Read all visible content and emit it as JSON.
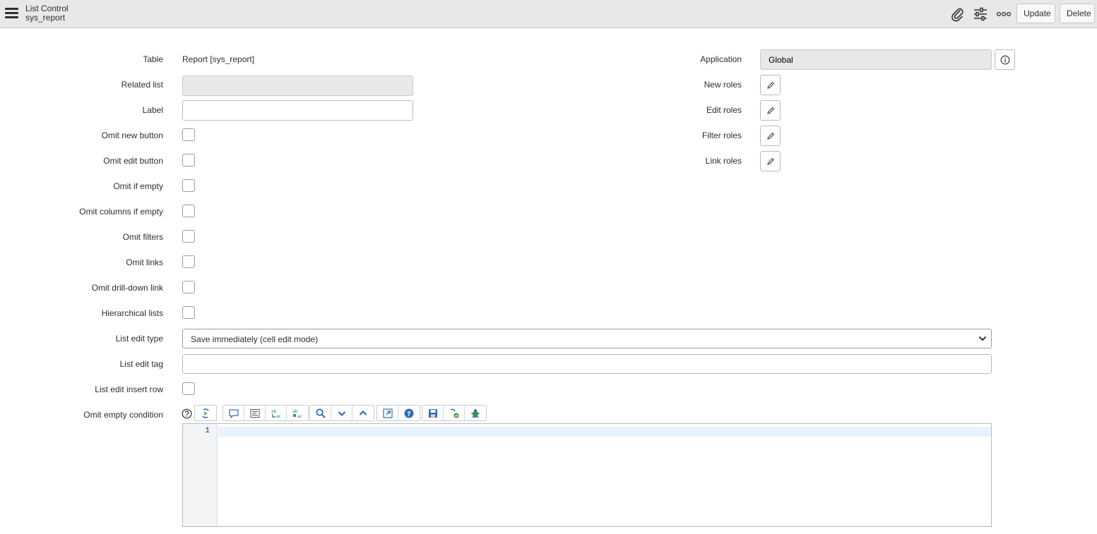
{
  "header": {
    "title": "List Control",
    "subtitle": "sys_report",
    "update_label": "Update",
    "delete_label": "Delete"
  },
  "form": {
    "left": {
      "table_label": "Table",
      "table_value": "Report [sys_report]",
      "related_list_label": "Related list",
      "related_list_value": "",
      "label_label": "Label",
      "label_value": "",
      "omit_new_button_label": "Omit new button",
      "omit_edit_button_label": "Omit edit button",
      "omit_if_empty_label": "Omit if empty",
      "omit_columns_if_empty_label": "Omit columns if empty",
      "omit_filters_label": "Omit filters",
      "omit_links_label": "Omit links",
      "omit_drill_down_link_label": "Omit drill-down link",
      "hierarchical_lists_label": "Hierarchical lists",
      "list_edit_type_label": "List edit type",
      "list_edit_type_value": "Save immediately (cell edit mode)",
      "list_edit_tag_label": "List edit tag",
      "list_edit_tag_value": "",
      "list_edit_insert_row_label": "List edit insert row",
      "omit_empty_condition_label": "Omit empty condition"
    },
    "right": {
      "application_label": "Application",
      "application_value": "Global",
      "new_roles_label": "New roles",
      "edit_roles_label": "Edit roles",
      "filter_roles_label": "Filter roles",
      "link_roles_label": "Link roles"
    }
  },
  "editor": {
    "line_number": "1",
    "content": ""
  },
  "icons": {
    "menu": "hamburger-icon",
    "attachment": "paperclip-icon",
    "personalize": "sliders-icon",
    "more": "more-options-icon",
    "info": "info-icon",
    "edit": "pencil-icon"
  },
  "colors": {
    "header_bg": "#e6e8ea",
    "readonly_bg": "#e7e8e9",
    "active_line": "#e8f2fe",
    "toolbar_blue": "#2e6fb6",
    "toolbar_green": "#3a9b3a"
  }
}
